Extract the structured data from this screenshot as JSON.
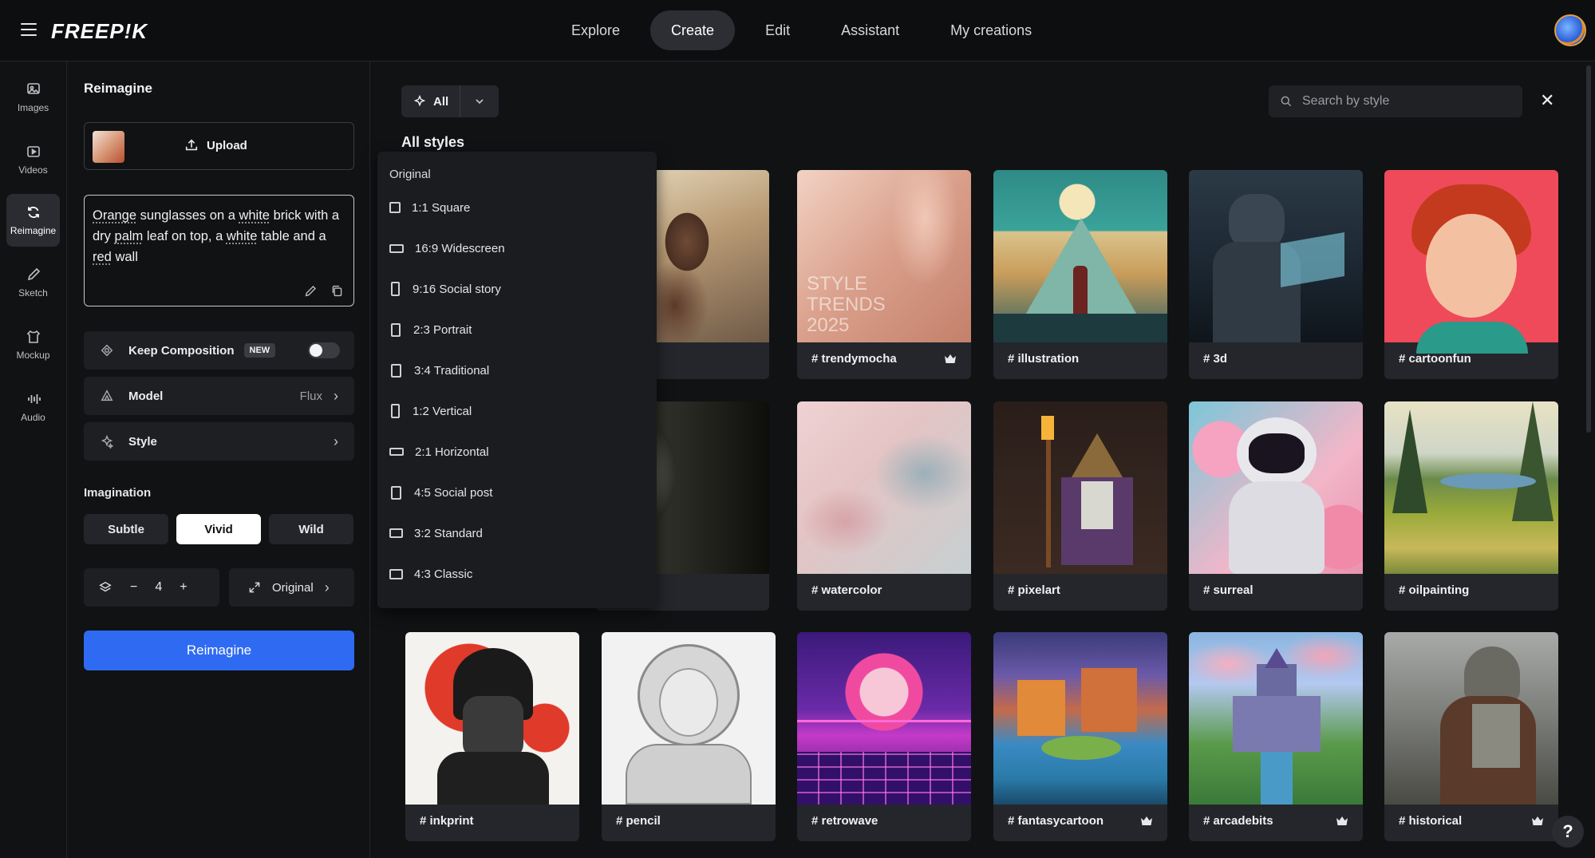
{
  "header": {
    "logo": "FREEP!K",
    "nav": [
      "Explore",
      "Create",
      "Edit",
      "Assistant",
      "My creations"
    ],
    "active_nav": "Create"
  },
  "rail": [
    {
      "label": "Images",
      "icon": "images-icon"
    },
    {
      "label": "Videos",
      "icon": "videos-icon"
    },
    {
      "label": "Reimagine",
      "icon": "reimagine-icon"
    },
    {
      "label": "Sketch",
      "icon": "sketch-icon"
    },
    {
      "label": "Mockup",
      "icon": "mockup-icon"
    },
    {
      "label": "Audio",
      "icon": "audio-icon"
    }
  ],
  "panel": {
    "title": "Reimagine",
    "upload_label": "Upload",
    "prompt": {
      "p1": "Orange",
      "p2": " sunglasses on a ",
      "p3": "white",
      "p4": " brick with a dry ",
      "p5": "palm",
      "p6": " leaf on top, a ",
      "p7": "white",
      "p8": " table and a ",
      "p9": "red",
      "p10": " wall"
    },
    "keep_composition": "Keep Composition",
    "new_badge": "NEW",
    "model_label": "Model",
    "model_value": "Flux",
    "style_label": "Style",
    "imagination_label": "Imagination",
    "imagination_options": [
      "Subtle",
      "Vivid",
      "Wild"
    ],
    "imagination_selected": "Vivid",
    "count": "4",
    "minus": "−",
    "plus": "+",
    "aspect_label": "Original",
    "cta": "Reimagine"
  },
  "main": {
    "filter_label": "All",
    "search_placeholder": "Search by style",
    "section_title": "All styles"
  },
  "dropdown": {
    "header": "Original",
    "items": [
      "1:1 Square",
      "16:9 Widescreen",
      "9:16 Social story",
      "2:3 Portrait",
      "3:4 Traditional",
      "1:2 Vertical",
      "2:1 Horizontal",
      "4:5 Social post",
      "3:2 Standard",
      "4:3 Classic"
    ]
  },
  "styles": [
    {
      "label": "# trendymocha",
      "premium": true
    },
    {
      "label": "# illustration",
      "premium": false
    },
    {
      "label": "# 3d",
      "premium": false
    },
    {
      "label": "# cartoonfun",
      "premium": false
    },
    {
      "label": "# watercolor",
      "premium": false
    },
    {
      "label": "# pixelart",
      "premium": false
    },
    {
      "label": "# surreal",
      "premium": false
    },
    {
      "label": "# oilpainting",
      "premium": false
    },
    {
      "label": "# inkprint",
      "premium": false
    },
    {
      "label": "# pencil",
      "premium": false
    },
    {
      "label": "# retrowave",
      "premium": false
    },
    {
      "label": "# fantasycartoon",
      "premium": true
    },
    {
      "label": "# arcadebits",
      "premium": true
    },
    {
      "label": "# historical",
      "premium": true
    }
  ],
  "help_label": "?"
}
